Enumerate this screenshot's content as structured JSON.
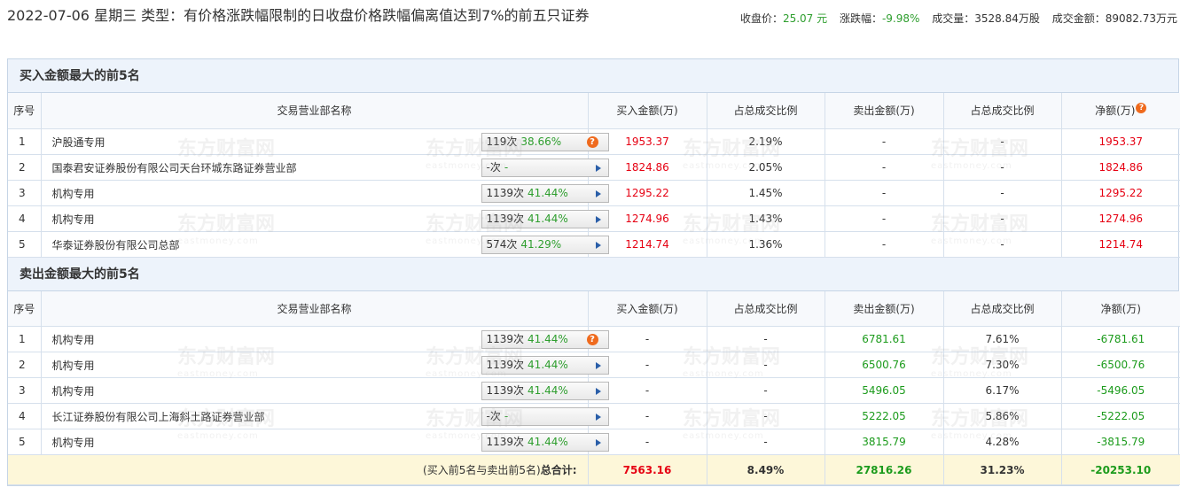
{
  "header": {
    "title": "2022-07-06 星期三 类型：有价格涨跌幅限制的日收盘价格跌幅偏离值达到7%的前五只证券",
    "close_label": "收盘价：",
    "close_value": "25.07 元",
    "change_label": "涨跌幅：",
    "change_value": "-9.98%",
    "volume_label": "成交量：",
    "volume_value": "3528.84万股",
    "amount_label": "成交金额：",
    "amount_value": "89082.73万元"
  },
  "watermark": {
    "cn": "东方财富网",
    "en": "eastmoney.com"
  },
  "columns": [
    "序号",
    "交易营业部名称",
    "买入金额(万)",
    "占总成交比例",
    "卖出金额(万)",
    "占总成交比例",
    "净额(万)"
  ],
  "buy_section": {
    "title": "买入金额最大的前5名",
    "rows": [
      {
        "seq": "1",
        "name": "沪股通专用",
        "times": "119次",
        "pct": "38.66%",
        "buy": "1953.37",
        "buy_ratio": "2.19%",
        "sell": "-",
        "sell_ratio": "-",
        "net": "1953.37",
        "icon": "question"
      },
      {
        "seq": "2",
        "name": "国泰君安证券股份有限公司天台环城东路证券营业部",
        "times": "-次",
        "pct": "-",
        "buy": "1824.86",
        "buy_ratio": "2.05%",
        "sell": "-",
        "sell_ratio": "-",
        "net": "1824.86",
        "icon": "arrow"
      },
      {
        "seq": "3",
        "name": "机构专用",
        "times": "1139次",
        "pct": "41.44%",
        "buy": "1295.22",
        "buy_ratio": "1.45%",
        "sell": "-",
        "sell_ratio": "-",
        "net": "1295.22",
        "icon": "arrow"
      },
      {
        "seq": "4",
        "name": "机构专用",
        "times": "1139次",
        "pct": "41.44%",
        "buy": "1274.96",
        "buy_ratio": "1.43%",
        "sell": "-",
        "sell_ratio": "-",
        "net": "1274.96",
        "icon": "arrow"
      },
      {
        "seq": "5",
        "name": "华泰证券股份有限公司总部",
        "times": "574次",
        "pct": "41.29%",
        "buy": "1214.74",
        "buy_ratio": "1.36%",
        "sell": "-",
        "sell_ratio": "-",
        "net": "1214.74",
        "icon": "arrow"
      }
    ]
  },
  "sell_section": {
    "title": "卖出金额最大的前5名",
    "rows": [
      {
        "seq": "1",
        "name": "机构专用",
        "times": "1139次",
        "pct": "41.44%",
        "buy": "-",
        "buy_ratio": "-",
        "sell": "6781.61",
        "sell_ratio": "7.61%",
        "net": "-6781.61",
        "icon": "question"
      },
      {
        "seq": "2",
        "name": "机构专用",
        "times": "1139次",
        "pct": "41.44%",
        "buy": "-",
        "buy_ratio": "-",
        "sell": "6500.76",
        "sell_ratio": "7.30%",
        "net": "-6500.76",
        "icon": "arrow"
      },
      {
        "seq": "3",
        "name": "机构专用",
        "times": "1139次",
        "pct": "41.44%",
        "buy": "-",
        "buy_ratio": "-",
        "sell": "5496.05",
        "sell_ratio": "6.17%",
        "net": "-5496.05",
        "icon": "arrow"
      },
      {
        "seq": "4",
        "name": "长江证券股份有限公司上海斜土路证券营业部",
        "times": "-次",
        "pct": "-",
        "buy": "-",
        "buy_ratio": "-",
        "sell": "5222.05",
        "sell_ratio": "5.86%",
        "net": "-5222.05",
        "icon": "arrow"
      },
      {
        "seq": "5",
        "name": "机构专用",
        "times": "1139次",
        "pct": "41.44%",
        "buy": "-",
        "buy_ratio": "-",
        "sell": "3815.79",
        "sell_ratio": "4.28%",
        "net": "-3815.79",
        "icon": "arrow"
      }
    ]
  },
  "total": {
    "label_prefix": "(买入前5名与卖出前5名)",
    "label_bold": "总合计:",
    "buy": "7563.16",
    "buy_ratio": "8.49%",
    "sell": "27816.26",
    "sell_ratio": "31.23%",
    "net": "-20253.10"
  },
  "colors": {
    "red": "#e60012",
    "green": "#1c9b1c",
    "header_bg": "#edf3fb",
    "total_bg": "#fdf7d9",
    "question_icon": "#ef6a1d",
    "arrow_icon": "#2a5ea8"
  }
}
